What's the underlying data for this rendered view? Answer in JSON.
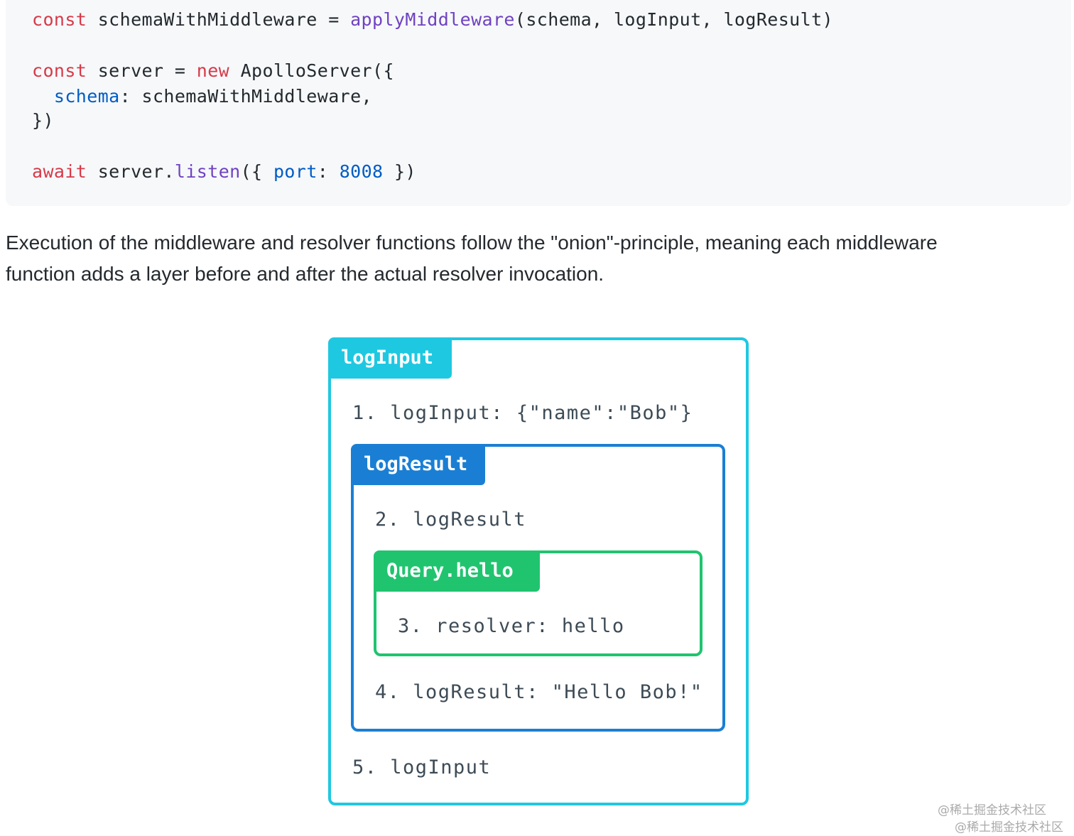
{
  "code": {
    "line1": {
      "kw": "const",
      "mid": " schemaWithMiddleware = ",
      "fn": "applyMiddleware",
      "rest": "(schema, logInput, logResult)"
    },
    "line2": {
      "kw": "const",
      "mid": " server = ",
      "kw2": "new",
      "rest": " ApolloServer({"
    },
    "line3": {
      "indent": "  ",
      "prop": "schema",
      "rest": ": schemaWithMiddleware,"
    },
    "line4": {
      "text": "})"
    },
    "line5": {
      "kw": "await",
      "mid": " server.",
      "fn": "listen",
      "open": "({ ",
      "prop": "port",
      "colon": ": ",
      "num": "8008",
      "close": " })"
    }
  },
  "paragraph": {
    "line1": "Execution of the middleware and resolver functions follow the \"onion\"-principle, meaning each middleware",
    "line2": "function adds a layer before and after the actual resolver invocation."
  },
  "diagram": {
    "outer": {
      "tag": "logInput",
      "step1": "1. logInput: {\"name\":\"Bob\"}",
      "step5": "5. logInput"
    },
    "middle": {
      "tag": "logResult",
      "step2": "2. logResult",
      "step4": "4. logResult: \"Hello Bob!\""
    },
    "inner": {
      "tag": "Query.hello",
      "step3": "3. resolver: hello"
    }
  },
  "watermarks": [
    "@稀土掘金技术社区",
    "@稀土掘金技术社区"
  ],
  "colors": {
    "outer": "#1fc8e1",
    "middle": "#1a7fd4",
    "inner": "#20c46f",
    "keyword": "#d73a49",
    "function": "#6f42c1",
    "property": "#005cc5"
  }
}
